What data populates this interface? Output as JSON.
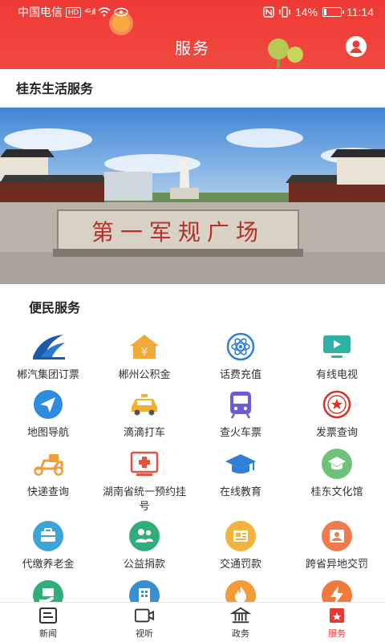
{
  "status_bar": {
    "carrier": "中国电信",
    "hd": "HD",
    "signal": "⁴ᴳ.ıll",
    "battery": "14%",
    "time": "11:14",
    "battery_level": 0.14
  },
  "header": {
    "title": "服务"
  },
  "section": {
    "title": "桂东生活服务"
  },
  "banner": {
    "plaque_text": "第一军规广场"
  },
  "services": {
    "title": "便民服务",
    "items": [
      {
        "label": "郴汽集团订票",
        "icon": "bus-company-logo-icon"
      },
      {
        "label": "郴州公积金",
        "icon": "fund-house-icon"
      },
      {
        "label": "话费充值",
        "icon": "atom-recharge-icon"
      },
      {
        "label": "有线电视",
        "icon": "tv-icon"
      },
      {
        "label": "地图导航",
        "icon": "navigation-icon"
      },
      {
        "label": "滴滴打车",
        "icon": "taxi-icon"
      },
      {
        "label": "查火车票",
        "icon": "train-icon"
      },
      {
        "label": "发票查询",
        "icon": "invoice-seal-icon"
      },
      {
        "label": "快递查询",
        "icon": "scooter-icon"
      },
      {
        "label": "湖南省统一预约挂号",
        "icon": "medical-cross-icon"
      },
      {
        "label": "在线教育",
        "icon": "graduation-cap-icon"
      },
      {
        "label": "桂东文化馆",
        "icon": "culture-hall-icon"
      },
      {
        "label": "代缴养老金",
        "icon": "briefcase-icon"
      },
      {
        "label": "公益捐款",
        "icon": "people-icon"
      },
      {
        "label": "交通罚款",
        "icon": "ticket-icon"
      },
      {
        "label": "跨省异地交罚",
        "icon": "person-card-icon"
      },
      {
        "label": "",
        "icon": "hand-money-icon"
      },
      {
        "label": "",
        "icon": "building-icon"
      },
      {
        "label": "",
        "icon": "flame-icon"
      },
      {
        "label": "",
        "icon": "bolt-icon"
      }
    ]
  },
  "tabs": [
    {
      "label": "新闻",
      "icon": "news-icon",
      "active": false
    },
    {
      "label": "视听",
      "icon": "video-icon",
      "active": false
    },
    {
      "label": "政务",
      "icon": "government-icon",
      "active": false
    },
    {
      "label": "服务",
      "icon": "service-star-icon",
      "active": true
    }
  ],
  "colors": {
    "header_red": "#ef3a35",
    "active_tab": "#e8382f",
    "blue": "#2f7fd8",
    "orange": "#f29b37",
    "green": "#2fae7a",
    "purple": "#6a5bd6"
  }
}
